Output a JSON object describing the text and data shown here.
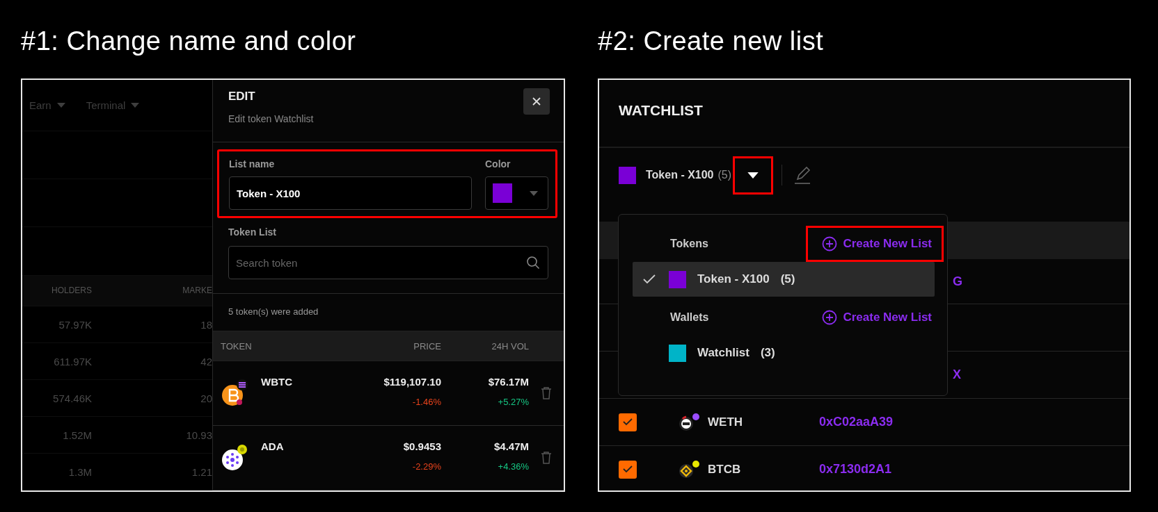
{
  "example_1": {
    "caption": "#1: Change name and color",
    "background": {
      "nav": [
        "Earn",
        "Terminal"
      ],
      "columns": [
        "HOLDERS",
        "MARKE"
      ],
      "rows": [
        [
          "57.97K",
          "18"
        ],
        [
          "611.97K",
          "42"
        ],
        [
          "574.46K",
          "20"
        ],
        [
          "1.52M",
          "10.93"
        ],
        [
          "1.3M",
          "1.21"
        ]
      ]
    },
    "edit": {
      "title": "EDIT",
      "subtitle": "Edit token Watchlist",
      "name_section": {
        "highlighted": true,
        "name_label": "List name",
        "name_value": "Token - X100",
        "color_label": "Color",
        "color": "#7a00d6"
      },
      "token_list_label": "Token List",
      "search_placeholder": "Search token",
      "added_note": "5 token(s) were added",
      "columns": [
        "TOKEN",
        "PRICE",
        "24H VOL"
      ],
      "tokens": [
        {
          "symbol": "WBTC",
          "price": "$119,107.10",
          "price_change": "-1.46%",
          "price_negative": true,
          "volume": "$76.17M",
          "volume_change": "+5.27%",
          "volume_negative": false
        },
        {
          "symbol": "ADA",
          "price": "$0.9453",
          "price_change": "-2.29%",
          "price_negative": true,
          "volume": "$4.47M",
          "volume_change": "+4.36%",
          "volume_negative": false
        }
      ]
    }
  },
  "example_2": {
    "caption": "#2: Create new list",
    "title": "WATCHLIST",
    "current": {
      "name": "Token - X100",
      "count": "(5)",
      "color": "#7a00d6",
      "caret_highlighted": true
    },
    "dropdown": {
      "groups": [
        {
          "heading": "Tokens",
          "action": "Create New List",
          "highlighted": true,
          "lists": [
            {
              "name": "Token - X100",
              "count": "(5)",
              "color": "#7a00d6",
              "selected": true
            }
          ]
        },
        {
          "heading": "Wallets",
          "action": "Create New List",
          "highlighted": false,
          "lists": [
            {
              "name": "Watchlist",
              "count": "(3)",
              "color": "#00b4c8",
              "selected": false
            }
          ]
        }
      ]
    },
    "background_fragments": [
      "G",
      "X"
    ],
    "rows": [
      {
        "checked": true,
        "symbol": "WETH",
        "address": "0xC02aaA39"
      },
      {
        "checked": true,
        "symbol": "BTCB",
        "address": "0x7130d2A1"
      }
    ]
  }
}
